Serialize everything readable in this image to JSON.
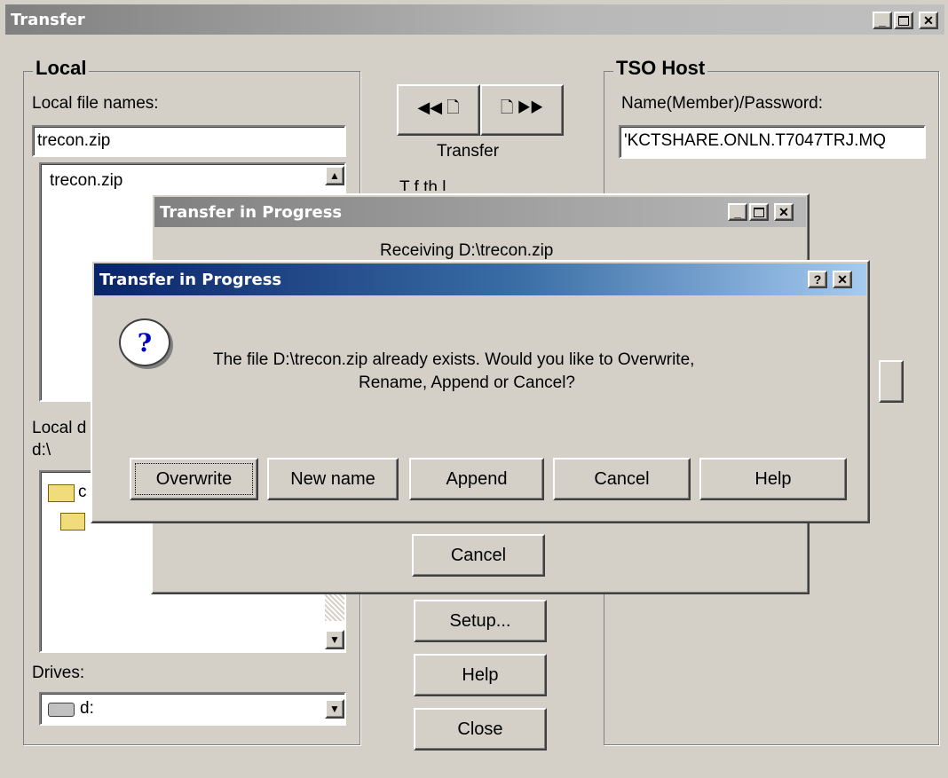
{
  "main_window": {
    "title": "Transfer",
    "local": {
      "legend": "Local",
      "file_names_label": "Local file names:",
      "file_input_value": "trecon.zip",
      "file_list": [
        "trecon.zip"
      ],
      "dir_label": "Local d",
      "dir_path": "d:\\",
      "dir_item": "c",
      "drives_label": "Drives:",
      "drive_value": "d:"
    },
    "transfer_label": "Transfer",
    "transfer_mode_partial": "T      f      th   l",
    "buttons": {
      "setup": "Setup...",
      "help": "Help",
      "close": "Close"
    },
    "tso": {
      "legend": "TSO Host",
      "name_label": "Name(Member)/Password:",
      "name_value": "'KCTSHARE.ONLN.T7047TRJ.MQ"
    }
  },
  "progress_window": {
    "title": "Transfer in Progress",
    "status": "Receiving D:\\trecon.zip",
    "cancel": "Cancel"
  },
  "dialog": {
    "title": "Transfer in Progress",
    "message_line1": "The file D:\\trecon.zip already exists. Would you like to Overwrite,",
    "message_line2": "Rename, Append or Cancel?",
    "buttons": {
      "overwrite": "Overwrite",
      "new_name": "New name",
      "append": "Append",
      "cancel": "Cancel",
      "help": "Help"
    }
  },
  "colors": {
    "face": "#d4d0c8",
    "title_active_start": "#0a246a",
    "title_active_end": "#a6caf0",
    "title_inactive": "#808080"
  }
}
